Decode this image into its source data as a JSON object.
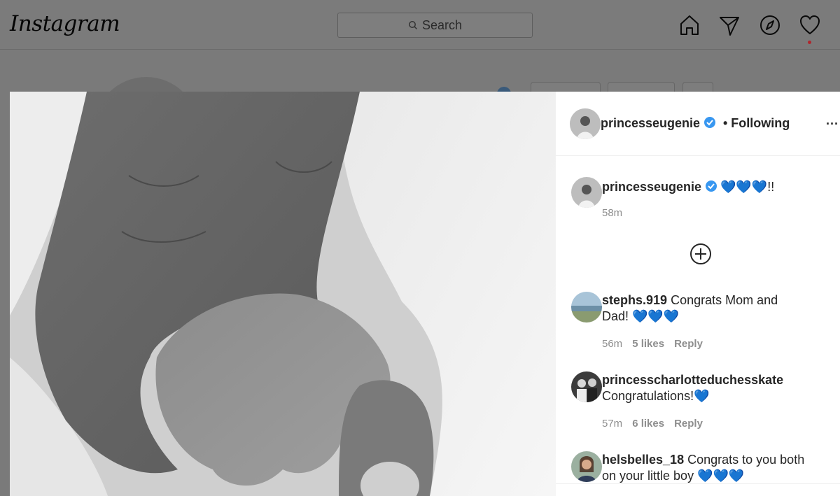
{
  "app": {
    "logo": "Instagram"
  },
  "topbar": {
    "search_placeholder": "Search"
  },
  "post": {
    "username": "princesseugenie",
    "follow_status": "• Following",
    "caption_emoji": "💙💙💙!!",
    "caption_time": "58m",
    "more_label": "···"
  },
  "comments": [
    {
      "username": "stephs.919",
      "text_line1": " Congrats Mom and",
      "text_line2": "Dad! 💙💙💙",
      "time": "56m",
      "likes": "5 likes",
      "reply": "Reply"
    },
    {
      "username": "princesscharlotteduchesskate",
      "text_line1": "",
      "text_line2": "Congratulations!💙",
      "time": "57m",
      "likes": "6 likes",
      "reply": "Reply"
    },
    {
      "username": "helsbelles_18",
      "text_line1": " Congrats to you both",
      "text_line2": "on your little boy 💙💙💙",
      "time": "",
      "likes": "",
      "reply": ""
    }
  ],
  "colors": {
    "verified": "#3897f0",
    "heart": "#1877f2",
    "notification": "#b0262d"
  },
  "icons": [
    "home-icon",
    "direct-icon",
    "explore-icon",
    "heart-icon",
    "search-icon",
    "load-more-icon"
  ]
}
